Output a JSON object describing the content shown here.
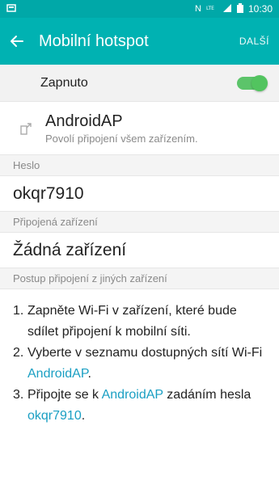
{
  "status_bar": {
    "time": "10:30",
    "left_icon": "notification-square-icon",
    "icons": [
      "nfc-icon",
      "lte-icon",
      "signal-icon",
      "battery-icon"
    ]
  },
  "action_bar": {
    "title": "Mobilní hotspot",
    "next_label": "DALŠÍ",
    "back_icon": "arrow-left-icon"
  },
  "toggle": {
    "label": "Zapnuto",
    "state": "on"
  },
  "network": {
    "name": "AndroidAP",
    "description": "Povolí připojení všem zařízením.",
    "icon": "share-icon"
  },
  "sections": {
    "password_header": "Heslo",
    "password_value": "okqr7910",
    "connected_header": "Připojená zařízení",
    "connected_value": "Žádná zařízení",
    "procedure_header": "Postup připojení z jiných zařízení"
  },
  "instructions": [
    {
      "num": "1.",
      "text": "Zapněte Wi-Fi v zařízení, které bude sdílet připojení k mobilní síti."
    },
    {
      "num": "2.",
      "text_pre": "Vyberte v seznamu dostupných sítí Wi-Fi ",
      "link": "AndroidAP",
      "text_post": "."
    },
    {
      "num": "3.",
      "text_pre": "Připojte se k ",
      "link": "AndroidAP",
      "text_mid": " zadáním hesla ",
      "link2": "okqr7910",
      "text_post": "."
    }
  ],
  "colors": {
    "status_bar": "#00a8a8",
    "action_bar": "#00b2b2",
    "switch_on": "#5cc46a",
    "link": "#1a9fc3"
  }
}
